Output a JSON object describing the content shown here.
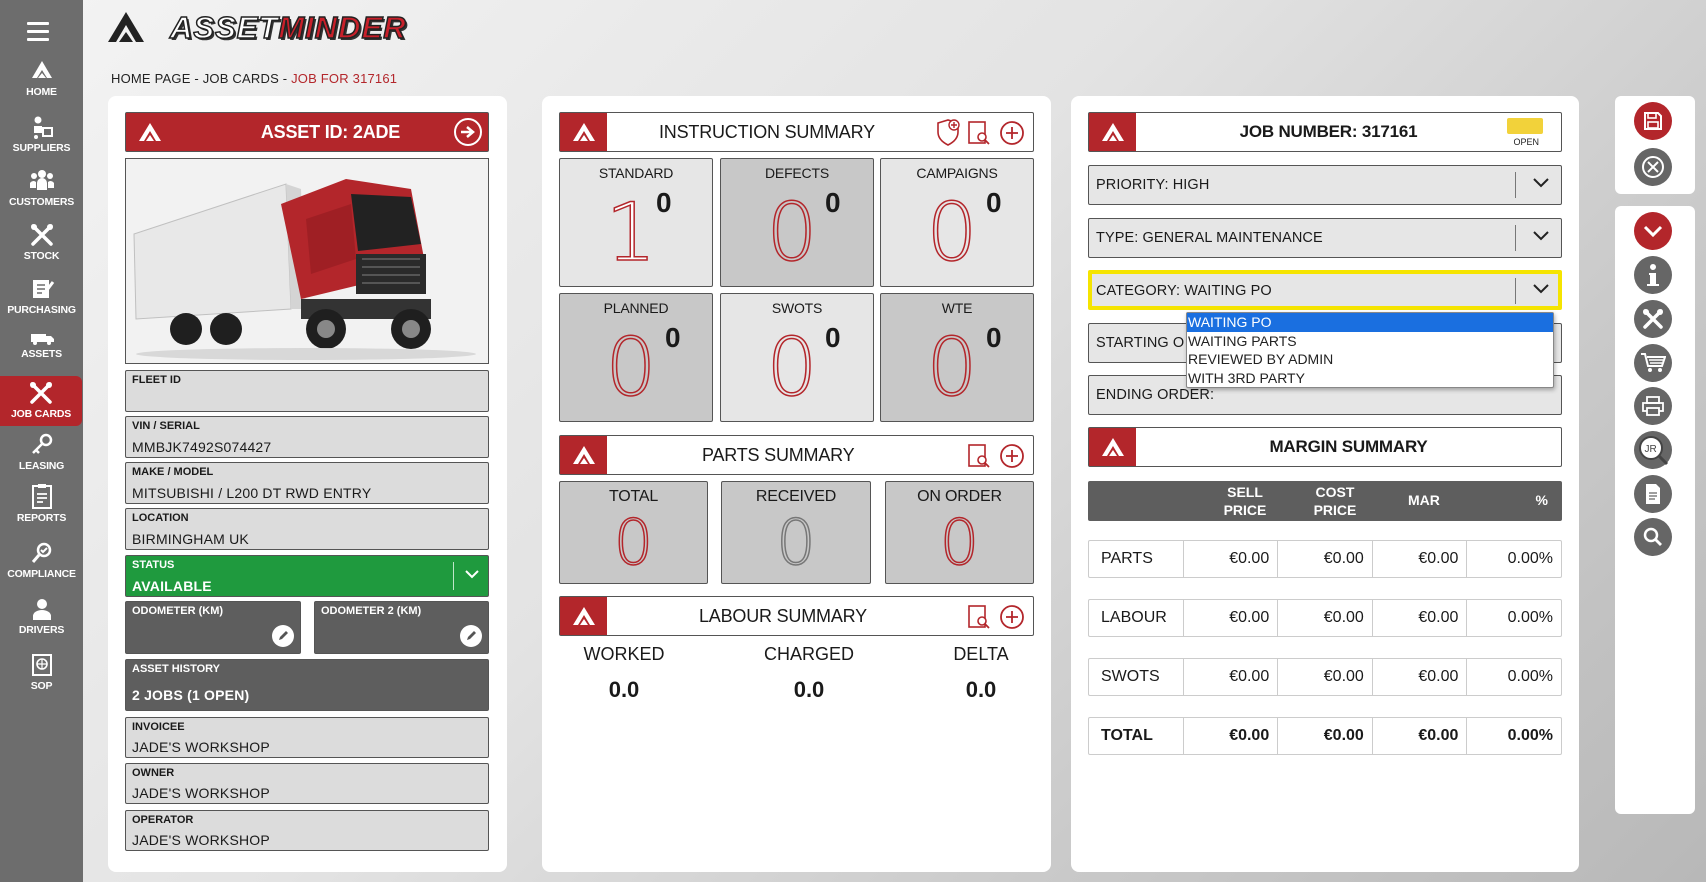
{
  "app": {
    "logo_word_a": "ASSET",
    "logo_word_b": "MINDER"
  },
  "nav": [
    {
      "label": "HOME",
      "icon": "home-icon"
    },
    {
      "label": "SUPPLIERS",
      "icon": "suppliers-icon"
    },
    {
      "label": "CUSTOMERS",
      "icon": "customers-icon"
    },
    {
      "label": "STOCK",
      "icon": "stock-icon"
    },
    {
      "label": "PURCHASING",
      "icon": "purchasing-icon"
    },
    {
      "label": "ASSETS",
      "icon": "assets-icon"
    },
    {
      "label": "JOB CARDS",
      "icon": "job-cards-icon",
      "active": true
    },
    {
      "label": "LEASING",
      "icon": "leasing-icon"
    },
    {
      "label": "REPORTS",
      "icon": "reports-icon"
    },
    {
      "label": "COMPLIANCE",
      "icon": "compliance-icon"
    },
    {
      "label": "DRIVERS",
      "icon": "drivers-icon"
    },
    {
      "label": "SOP",
      "icon": "sop-icon"
    }
  ],
  "breadcrumb": {
    "home": "HOME PAGE",
    "sep": " - ",
    "jobcards": "JOB CARDS",
    "current": "JOB FOR 317161"
  },
  "asset": {
    "title": "ASSET ID: 2ADE",
    "fleet_label": "FLEET ID",
    "fleet_value": "",
    "vin_label": "VIN / SERIAL",
    "vin_value": "MMBJK7492S074427",
    "make_label": "MAKE / MODEL",
    "make_value": "MITSUBISHI / L200 DT RWD ENTRY",
    "location_label": "LOCATION",
    "location_value": "BIRMINGHAM UK",
    "status_label": "STATUS",
    "status_value": "AVAILABLE",
    "odo_label": "ODOMETER (KM)",
    "odo2_label": "ODOMETER 2 (KM)",
    "history_label": "ASSET HISTORY",
    "history_value": "2 JOBS (1 OPEN)",
    "invoicee_label": "INVOICEE",
    "invoicee_value": "JADE'S WORKSHOP",
    "owner_label": "OWNER",
    "owner_value": "JADE'S WORKSHOP",
    "operator_label": "OPERATOR",
    "operator_value": "JADE'S WORKSHOP"
  },
  "instruction": {
    "title": "INSTRUCTION SUMMARY",
    "tiles": [
      {
        "label": "STANDARD",
        "count": "0",
        "big": "1"
      },
      {
        "label": "DEFECTS",
        "count": "0",
        "big": "0"
      },
      {
        "label": "CAMPAIGNS",
        "count": "0",
        "big": "0"
      },
      {
        "label": "PLANNED",
        "count": "0",
        "big": "0"
      },
      {
        "label": "SWOTS",
        "count": "0",
        "big": "0"
      },
      {
        "label": "WTE",
        "count": "0",
        "big": "0"
      }
    ]
  },
  "parts": {
    "title": "PARTS SUMMARY",
    "tiles": [
      {
        "label": "TOTAL",
        "big": "0"
      },
      {
        "label": "RECEIVED",
        "big": "0"
      },
      {
        "label": "ON ORDER",
        "big": "0"
      }
    ]
  },
  "labour": {
    "title": "LABOUR SUMMARY",
    "cols": [
      {
        "label": "WORKED",
        "value": "0.0"
      },
      {
        "label": "CHARGED",
        "value": "0.0"
      },
      {
        "label": "DELTA",
        "value": "0.0"
      }
    ]
  },
  "job": {
    "title": "JOB NUMBER: 317161",
    "status": "OPEN",
    "status_color": "#f2d23a",
    "priority": "PRIORITY: HIGH",
    "type": "TYPE: GENERAL MAINTENANCE",
    "category": "CATEGORY: WAITING PO",
    "starting": "STARTING O",
    "ending": "ENDING ORDER:",
    "category_options": [
      "WAITING PO",
      "WAITING PARTS",
      "REVIEWED BY ADMIN",
      "WITH 3RD PARTY"
    ]
  },
  "margin": {
    "title": "MARGIN SUMMARY",
    "headers": [
      "SELL PRICE",
      "COST PRICE",
      "MAR",
      "%"
    ],
    "header_sell_1": "SELL",
    "header_sell_2": "PRICE",
    "header_cost_1": "COST",
    "header_cost_2": "PRICE",
    "rows": [
      {
        "name": "PARTS",
        "sell": "€0.00",
        "cost": "€0.00",
        "mar": "€0.00",
        "pct": "0.00%"
      },
      {
        "name": "LABOUR",
        "sell": "€0.00",
        "cost": "€0.00",
        "mar": "€0.00",
        "pct": "0.00%"
      },
      {
        "name": "SWOTS",
        "sell": "€0.00",
        "cost": "€0.00",
        "mar": "€0.00",
        "pct": "0.00%"
      },
      {
        "name": "TOTAL",
        "sell": "€0.00",
        "cost": "€0.00",
        "mar": "€0.00",
        "pct": "0.00%"
      }
    ]
  },
  "colors": {
    "brand_red": "#b3262b",
    "status_green": "#1f9a3e",
    "sidebar": "#6d6d6d",
    "highlight_yellow": "#f5e400",
    "select_blue": "#1a6fe0"
  }
}
